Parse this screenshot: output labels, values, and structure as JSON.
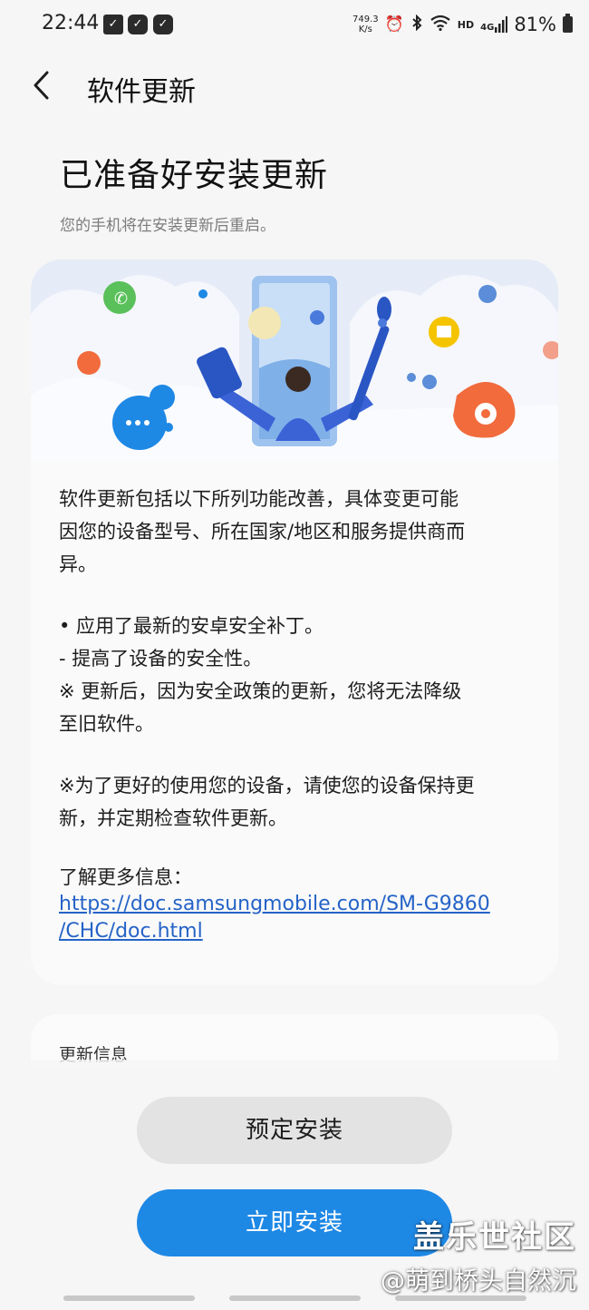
{
  "status_bar": {
    "time": "22:44",
    "net_speed_value": "749.3",
    "net_speed_unit": "K/s",
    "hd": "HD",
    "network": "4G",
    "battery": "81%"
  },
  "header": {
    "title": "软件更新"
  },
  "main": {
    "headline": "已准备好安装更新",
    "subtitle": "您的手机将在安装更新后重启。",
    "description": [
      "软件更新包括以下所列功能改善，具体变更可能",
      "因您的设备型号、所在国家/地区和服务提供商而",
      "异。"
    ],
    "bullets": [
      "• 应用了最新的安卓安全补丁。",
      " - 提高了设备的安全性。",
      "※ 更新后，因为安全政策的更新，您将无法降级",
      "至旧软件。"
    ],
    "note": [
      "※为了更好的使用您的设备，请使您的设备保持更",
      "新，并定期检查软件更新。"
    ],
    "more_info_label": "了解更多信息：",
    "more_info_link_1": "https://doc.samsungmobile.com/SM-G9860",
    "more_info_link_2": "/CHC/doc.html"
  },
  "info_card": {
    "label": "更新信息"
  },
  "buttons": {
    "schedule_label": "预定安装",
    "install_label": "立即安装"
  },
  "watermark": {
    "brand": "盖乐世社区",
    "user": "@萌到桥头自然沉"
  },
  "colors": {
    "background": "#f6f6f6",
    "primary_button": "#1e88e5",
    "secondary_button": "#e3e3e3",
    "link": "#2563c7"
  },
  "icons": [
    "back-chevron-icon",
    "alarm-icon",
    "bluetooth-icon",
    "wifi-icon",
    "signal-icon",
    "battery-icon"
  ]
}
